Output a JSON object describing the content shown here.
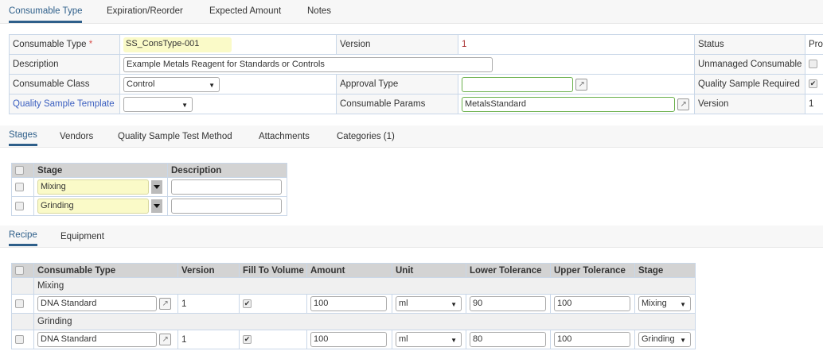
{
  "top_tabs": [
    "Consumable Type",
    "Expiration/Reorder",
    "Expected Amount",
    "Notes"
  ],
  "form": {
    "consumable_type_label": "Consumable Type",
    "required_mark": "*",
    "consumable_type_value": "SS_ConsType-001",
    "version_label": "Version",
    "version_value": "1",
    "status_label": "Status",
    "status_value": "Prov",
    "description_label": "Description",
    "description_value": "Example Metals Reagent for Standards or Controls",
    "unmanaged_label": "Unmanaged Consumable",
    "class_label": "Consumable Class",
    "class_value": "Control",
    "approval_label": "Approval Type",
    "approval_value": "",
    "qs_required_label": "Quality Sample Required",
    "qs_template_label": "Quality Sample Template",
    "qs_template_value": "",
    "params_label": "Consumable Params",
    "params_value": "MetalsStandard",
    "params_version_label": "Version",
    "params_version_value": "1"
  },
  "mid_tabs": [
    "Stages",
    "Vendors",
    "Quality Sample Test Method",
    "Attachments",
    "Categories (1)"
  ],
  "stages": {
    "headers": [
      "Stage",
      "Description"
    ],
    "rows": [
      {
        "stage": "Mixing",
        "description": ""
      },
      {
        "stage": "Grinding",
        "description": ""
      }
    ]
  },
  "bottom_tabs": [
    "Recipe",
    "Equipment"
  ],
  "recipe": {
    "headers": [
      "Consumable Type",
      "Version",
      "Fill To Volume",
      "Amount",
      "Unit",
      "Lower Tolerance",
      "Upper Tolerance",
      "Stage"
    ],
    "groups": [
      {
        "name": "Mixing",
        "row": {
          "type": "DNA Standard",
          "version": "1",
          "amount": "100",
          "unit": "ml",
          "lower": "90",
          "upper": "100",
          "stage": "Mixing"
        }
      },
      {
        "name": "Grinding",
        "row": {
          "type": "DNA Standard",
          "version": "1",
          "amount": "100",
          "unit": "ml",
          "lower": "80",
          "upper": "100",
          "stage": "Grinding"
        }
      }
    ]
  }
}
